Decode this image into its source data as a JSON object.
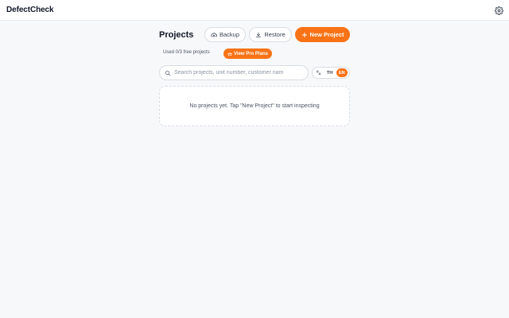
{
  "app": {
    "brand": "DefectCheck",
    "settings_icon": "gear-icon"
  },
  "header": {
    "title": "Projects",
    "backup_label": "Backup",
    "backup_icon": "cloud-upload-icon",
    "restore_label": "Restore",
    "restore_icon": "download-icon",
    "new_project_label": "New Project",
    "new_project_icon": "plus-icon"
  },
  "usage": {
    "text": "Used 0/3 free projects",
    "pro_label": "View Pro Plans",
    "pro_icon": "crown-icon"
  },
  "search": {
    "placeholder": "Search projects, unit number, customer nam",
    "value": "",
    "icon": "search-icon"
  },
  "language": {
    "icon": "translate-icon",
    "options": [
      "TH",
      "EN"
    ],
    "selected": "EN"
  },
  "empty_state": {
    "message": "No projects yet. Tap \"New Project\" to start inspecting"
  },
  "colors": {
    "accent": "#f97316",
    "background": "#f7f8fa",
    "surface": "#ffffff",
    "border": "#d9dce2"
  }
}
